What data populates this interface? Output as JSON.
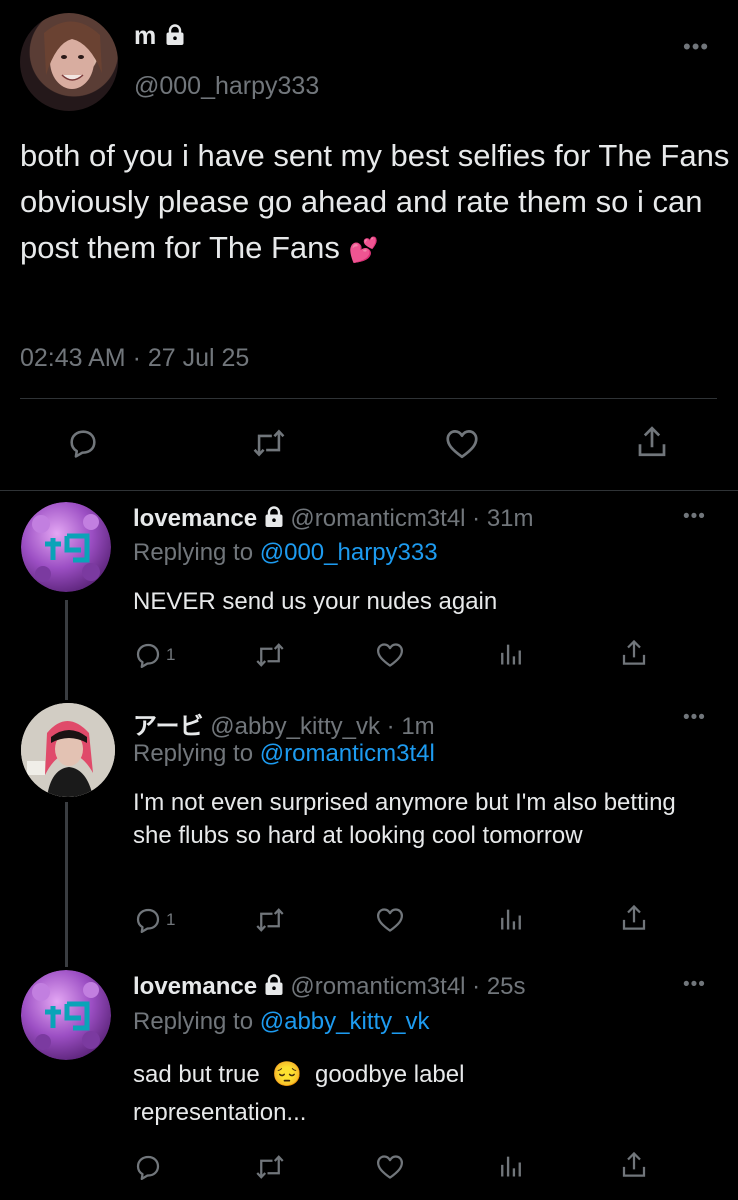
{
  "main_tweet": {
    "display_name": "m",
    "handle": "@000_harpy333",
    "text": "both of you i have sent my best selfies for The Fans obviously please go ahead and rate them so i can post them for The Fans",
    "emoji": "💕",
    "timestamp": "02:43 AM · 27 Jul 25",
    "more_label": "•••"
  },
  "replies": [
    {
      "display_name": "lovemance",
      "handle": "@romanticm3t4l · 31m",
      "replying_prefix": "Replying to",
      "replying_to": "@000_harpy333",
      "text": "NEVER send us your nudes again",
      "reply_count": "1",
      "more_label": "•••"
    },
    {
      "display_name": "アービ",
      "handle": "@abby_kitty_vk · 1m",
      "replying_prefix": "Replying to",
      "replying_to": "@romanticm3t4l",
      "text": "I'm not even surprised anymore but I'm also betting she flubs so hard at looking cool tomorrow",
      "reply_count": "1",
      "more_label": "•••"
    },
    {
      "display_name": "lovemance",
      "handle": "@romanticm3t4l · 25s",
      "replying_prefix": "Replying to",
      "replying_to": "@abby_kitty_vk",
      "text": "sad but true",
      "emoji": "😔",
      "text_after_emoji": "goodbye label representation...",
      "reply_count": "",
      "more_label": "•••"
    }
  ],
  "colors": {
    "background": "#000000",
    "text": "#e7e9ea",
    "muted": "#71767b",
    "link": "#1d9bf0",
    "divider": "#2f3336"
  },
  "icons": [
    "lock-icon",
    "more-icon",
    "reply-icon",
    "retweet-icon",
    "like-icon",
    "share-icon",
    "analytics-icon"
  ]
}
